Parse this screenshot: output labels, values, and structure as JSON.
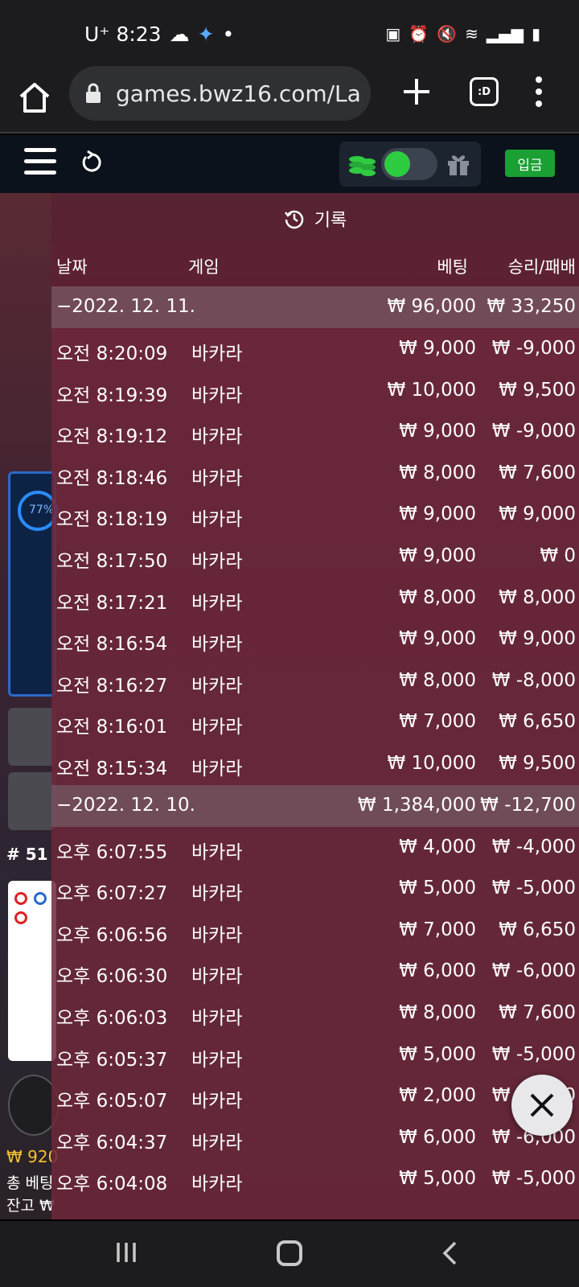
{
  "status_bar": {
    "carrier_time": "U⁺ 8:23"
  },
  "browser": {
    "url": "games.bwz16.com/La",
    "tabs_label": ":D"
  },
  "game_header": {
    "deposit_label": "입금"
  },
  "background": {
    "round": "# 51",
    "balance_line1": "₩ 920",
    "balance_line2": "총 베팅",
    "balance_line3": "잔고 ₩",
    "percent": "77%"
  },
  "history": {
    "title": "기록",
    "columns": {
      "date": "날짜",
      "game": "게임",
      "bet": "베팅",
      "win_loss": "승리/패배"
    },
    "rows": [
      {
        "type": "date",
        "date": "−2022. 12. 11.",
        "bet": "₩ 96,000",
        "win": "₩ 33,250"
      },
      {
        "type": "item",
        "date": "오전 8:20:09",
        "game": "바카라",
        "bet": "₩ 9,000",
        "win": "₩ -9,000"
      },
      {
        "type": "item",
        "date": "오전 8:19:39",
        "game": "바카라",
        "bet": "₩ 10,000",
        "win": "₩ 9,500"
      },
      {
        "type": "item",
        "date": "오전 8:19:12",
        "game": "바카라",
        "bet": "₩ 9,000",
        "win": "₩ -9,000"
      },
      {
        "type": "item",
        "date": "오전 8:18:46",
        "game": "바카라",
        "bet": "₩ 8,000",
        "win": "₩ 7,600"
      },
      {
        "type": "item",
        "date": "오전 8:18:19",
        "game": "바카라",
        "bet": "₩ 9,000",
        "win": "₩ 9,000"
      },
      {
        "type": "item",
        "date": "오전 8:17:50",
        "game": "바카라",
        "bet": "₩ 9,000",
        "win": "₩ 0"
      },
      {
        "type": "item",
        "date": "오전 8:17:21",
        "game": "바카라",
        "bet": "₩ 8,000",
        "win": "₩ 8,000"
      },
      {
        "type": "item",
        "date": "오전 8:16:54",
        "game": "바카라",
        "bet": "₩ 9,000",
        "win": "₩ 9,000"
      },
      {
        "type": "item",
        "date": "오전 8:16:27",
        "game": "바카라",
        "bet": "₩ 8,000",
        "win": "₩ -8,000"
      },
      {
        "type": "item",
        "date": "오전 8:16:01",
        "game": "바카라",
        "bet": "₩ 7,000",
        "win": "₩ 6,650"
      },
      {
        "type": "item",
        "date": "오전 8:15:34",
        "game": "바카라",
        "bet": "₩ 10,000",
        "win": "₩ 9,500"
      },
      {
        "type": "date",
        "date": "−2022. 12. 10.",
        "bet": "₩ 1,384,000",
        "win": "₩ -12,700"
      },
      {
        "type": "item",
        "date": "오후 6:07:55",
        "game": "바카라",
        "bet": "₩ 4,000",
        "win": "₩ -4,000"
      },
      {
        "type": "item",
        "date": "오후 6:07:27",
        "game": "바카라",
        "bet": "₩ 5,000",
        "win": "₩ -5,000"
      },
      {
        "type": "item",
        "date": "오후 6:06:56",
        "game": "바카라",
        "bet": "₩ 7,000",
        "win": "₩ 6,650"
      },
      {
        "type": "item",
        "date": "오후 6:06:30",
        "game": "바카라",
        "bet": "₩ 6,000",
        "win": "₩ -6,000"
      },
      {
        "type": "item",
        "date": "오후 6:06:03",
        "game": "바카라",
        "bet": "₩ 8,000",
        "win": "₩ 7,600"
      },
      {
        "type": "item",
        "date": "오후 6:05:37",
        "game": "바카라",
        "bet": "₩ 5,000",
        "win": "₩ -5,000"
      },
      {
        "type": "item",
        "date": "오후 6:05:07",
        "game": "바카라",
        "bet": "₩ 2,000",
        "win": "₩ -2,000"
      },
      {
        "type": "item",
        "date": "오후 6:04:37",
        "game": "바카라",
        "bet": "₩ 6,000",
        "win": "₩ -6,000"
      },
      {
        "type": "item",
        "date": "오후 6:04:08",
        "game": "바카라",
        "bet": "₩ 5,000",
        "win": "₩ -5,000"
      }
    ]
  },
  "icons": {
    "home": "home-icon",
    "lock": "lock-icon",
    "plus": "plus-icon",
    "menu": "more-vert-icon",
    "hamburger": "hamburger-icon",
    "reload": "reload-icon",
    "coins": "coins-icon",
    "gift": "gift-icon",
    "history": "history-icon",
    "close": "close-icon"
  },
  "colors": {
    "accent_green": "#2ecc40",
    "deposit": "#1aa033",
    "overlay": "#6e283a"
  }
}
